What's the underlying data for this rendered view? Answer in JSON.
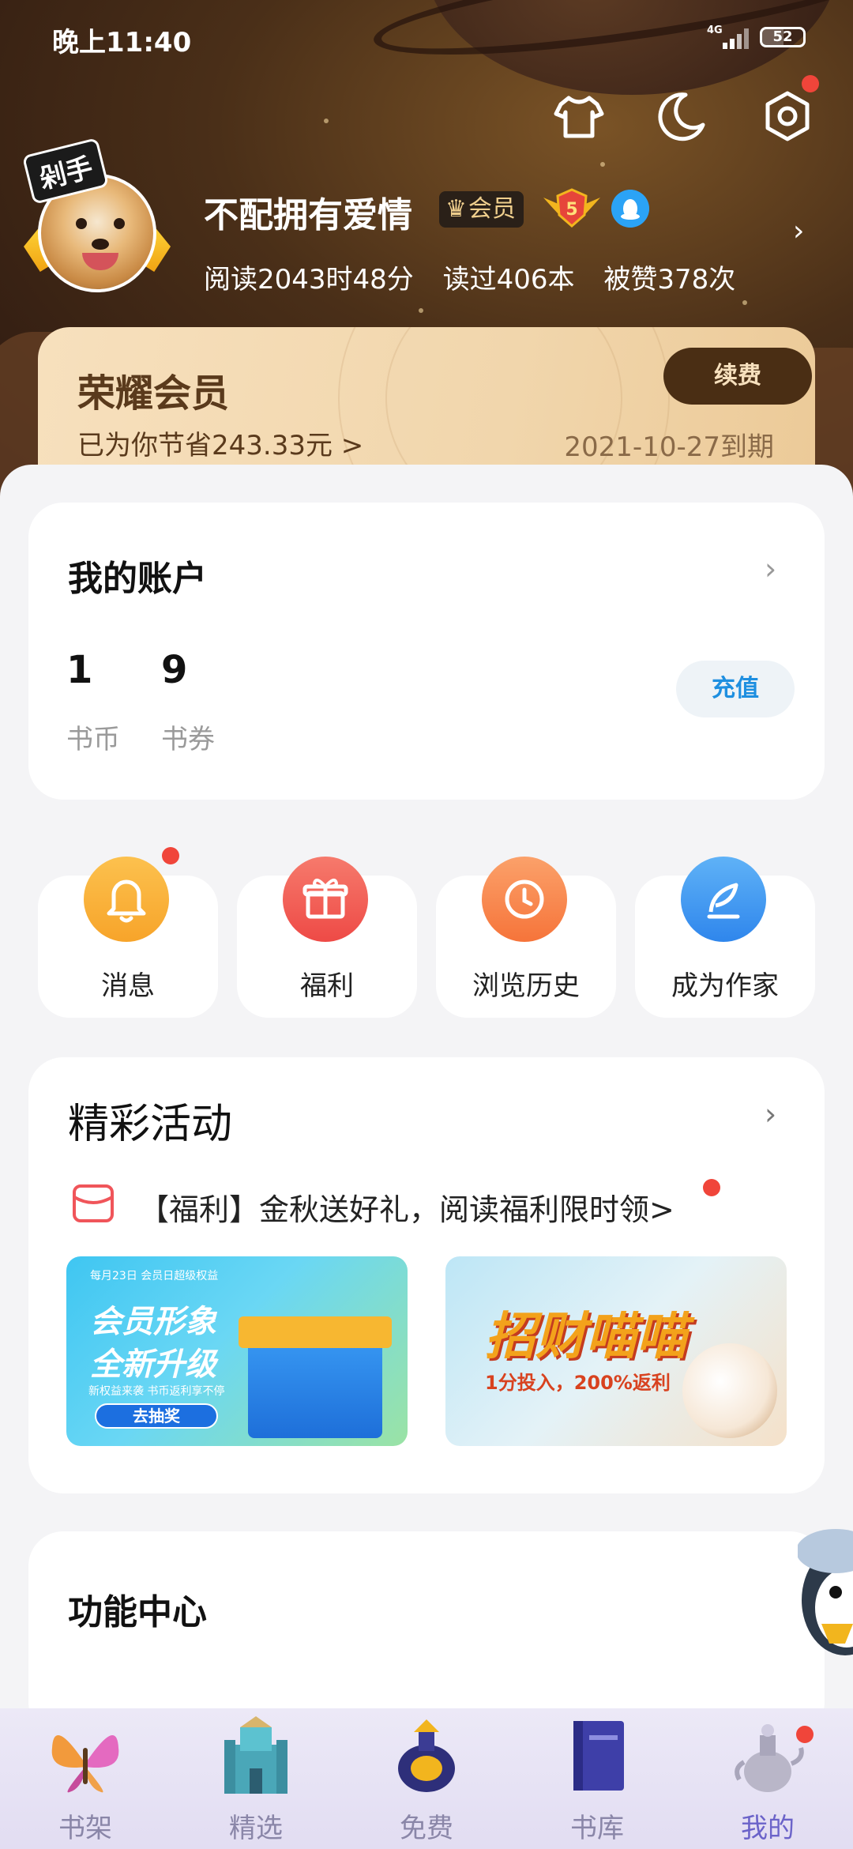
{
  "status_bar": {
    "time": "晚上11:40",
    "network": "4G",
    "battery": "52"
  },
  "profile": {
    "username": "不配拥有爱情",
    "vip_tag": "会员",
    "level": "5",
    "frame_badge": "剁手",
    "stats": {
      "read_time": "阅读2043时48分",
      "books_read": "读过406本",
      "likes": "被赞378次"
    }
  },
  "vip_card": {
    "title": "荣耀会员",
    "saved": "已为你节省243.33元 >",
    "renew": "续费",
    "expire": "2021-10-27到期"
  },
  "account": {
    "title": "我的账户",
    "coins_value": "1",
    "coins_label": "书币",
    "coupons_value": "9",
    "coupons_label": "书券",
    "recharge": "充值"
  },
  "quick_actions": [
    {
      "label": "消息",
      "icon": "bell-icon",
      "color": "#fbb03b"
    },
    {
      "label": "福利",
      "icon": "gift-icon",
      "color": "#f25f58"
    },
    {
      "label": "浏览历史",
      "icon": "clock-icon",
      "color": "#f98a4c"
    },
    {
      "label": "成为作家",
      "icon": "pen-icon",
      "color": "#3d9af2"
    }
  ],
  "events": {
    "title": "精彩活动",
    "notice": "【福利】金秋送好礼，阅读福利限时领>",
    "banner1": {
      "small": "每月23日 会员日超级权益",
      "line1": "会员形象",
      "line2": "全新升级",
      "small2": "新权益来袭 书币返利享不停",
      "button": "去抽奖"
    },
    "banner2": {
      "main": "招财喵喵",
      "sub": "1分投入，200%返利"
    }
  },
  "functions": {
    "title": "功能中心"
  },
  "bottom_nav": [
    {
      "label": "书架",
      "icon": "butterfly-icon"
    },
    {
      "label": "精选",
      "icon": "castle-icon"
    },
    {
      "label": "免费",
      "icon": "vase-icon"
    },
    {
      "label": "书库",
      "icon": "book-icon"
    },
    {
      "label": "我的",
      "icon": "teapot-icon",
      "active": true
    }
  ],
  "colors": {
    "accent": "#1e8fe0",
    "vip_brown": "#4a2e14",
    "nav_active": "#6b63c9",
    "badge_red": "#f0453a"
  }
}
